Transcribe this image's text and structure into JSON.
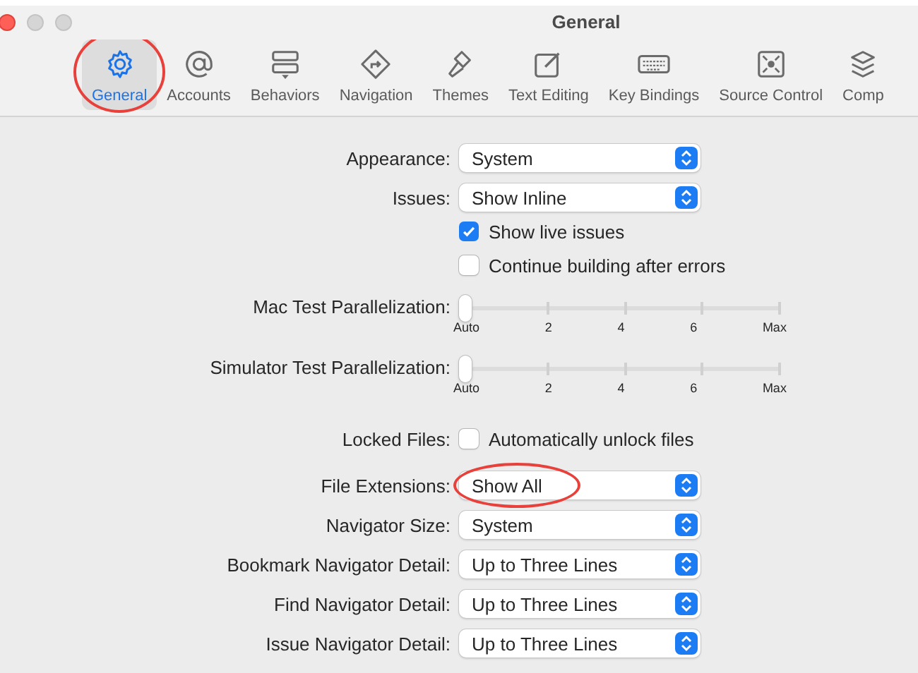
{
  "window": {
    "title": "General"
  },
  "toolbar": [
    {
      "kind": "gear",
      "label": "General",
      "selected": true,
      "highlighted": true
    },
    {
      "kind": "at",
      "label": "Accounts",
      "selected": false,
      "highlighted": false
    },
    {
      "kind": "behaviors",
      "label": "Behaviors",
      "selected": false,
      "highlighted": false
    },
    {
      "kind": "navigation",
      "label": "Navigation",
      "selected": false,
      "highlighted": false
    },
    {
      "kind": "brush",
      "label": "Themes",
      "selected": false,
      "highlighted": false
    },
    {
      "kind": "edit",
      "label": "Text Editing",
      "selected": false,
      "highlighted": false
    },
    {
      "kind": "keyboard",
      "label": "Key Bindings",
      "selected": false,
      "highlighted": false
    },
    {
      "kind": "source",
      "label": "Source Control",
      "selected": false,
      "highlighted": false
    },
    {
      "kind": "stack",
      "label": "Comp",
      "selected": false,
      "highlighted": false
    }
  ],
  "settings": [
    {
      "kind": "popup",
      "label": "Appearance:",
      "value": "System",
      "highlighted": false
    },
    {
      "kind": "popup",
      "label": "Issues:",
      "value": "Show Inline",
      "highlighted": false
    },
    {
      "kind": "checkbox",
      "text": "Show live issues",
      "checked": true
    },
    {
      "kind": "checkbox",
      "text": "Continue building after errors",
      "checked": false
    },
    {
      "kind": "slider",
      "label": "Mac Test Parallelization:",
      "level": 0,
      "ticks": [
        "Auto",
        "2",
        "4",
        "6",
        "Max"
      ]
    },
    {
      "kind": "slider",
      "label": "Simulator Test Parallelization:",
      "level": 0,
      "ticks": [
        "Auto",
        "2",
        "4",
        "6",
        "Max"
      ]
    },
    {
      "kind": "checkbox",
      "label": "Locked Files:",
      "text": "Automatically unlock files",
      "checked": false
    },
    {
      "kind": "popup",
      "label": "File Extensions:",
      "value": "Show All",
      "highlighted": true
    },
    {
      "kind": "popup",
      "label": "Navigator Size:",
      "value": "System",
      "highlighted": false
    },
    {
      "kind": "popup",
      "label": "Bookmark Navigator Detail:",
      "value": "Up to Three Lines",
      "highlighted": false
    },
    {
      "kind": "popup",
      "label": "Find Navigator Detail:",
      "value": "Up to Three Lines",
      "highlighted": false
    },
    {
      "kind": "popup",
      "label": "Issue Navigator Detail:",
      "value": "Up to Three Lines",
      "highlighted": false
    }
  ]
}
